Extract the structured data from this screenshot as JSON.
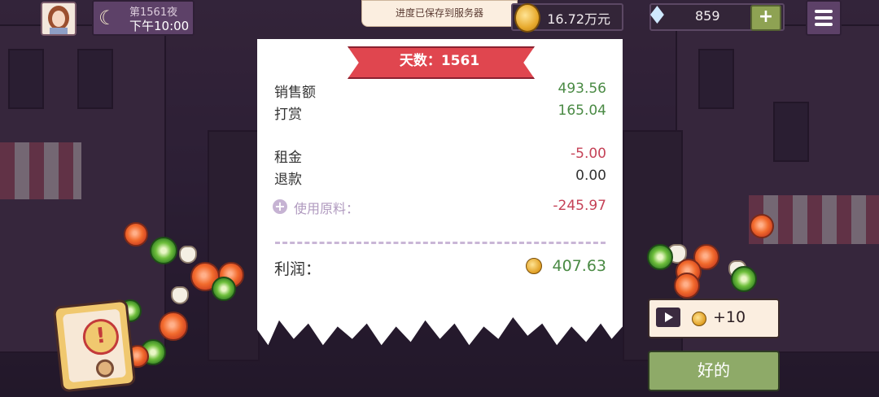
{
  "top_bar": {
    "day_label": "第1561夜",
    "time_label": "下午10:00",
    "save_toast": "进度已保存到服务器",
    "money": "16.72万元",
    "gems": "859",
    "add_gems_label": "+"
  },
  "receipt": {
    "ribbon_title": "天数：1561",
    "rows": [
      {
        "label": "销售额",
        "value": "493.56"
      },
      {
        "label": "打赏",
        "value": "165.04"
      },
      {
        "label": "租金",
        "value": "-5.00"
      },
      {
        "label": "退款",
        "value": "0.00"
      },
      {
        "label": "使用原料：",
        "value": "-245.97"
      }
    ],
    "profit_label": "利润：",
    "profit_value": "407.63"
  },
  "buttons": {
    "ad_reward": "+10",
    "ok": "好的"
  },
  "colors": {
    "positive": "#4a8a44",
    "negative": "#c54257",
    "ribbon": "#e0464f",
    "ok_button": "#8eaa68"
  },
  "icons": [
    "moon-icon",
    "coin-icon",
    "diamond-icon",
    "menu-icon",
    "video-play-icon",
    "alert-icon"
  ]
}
